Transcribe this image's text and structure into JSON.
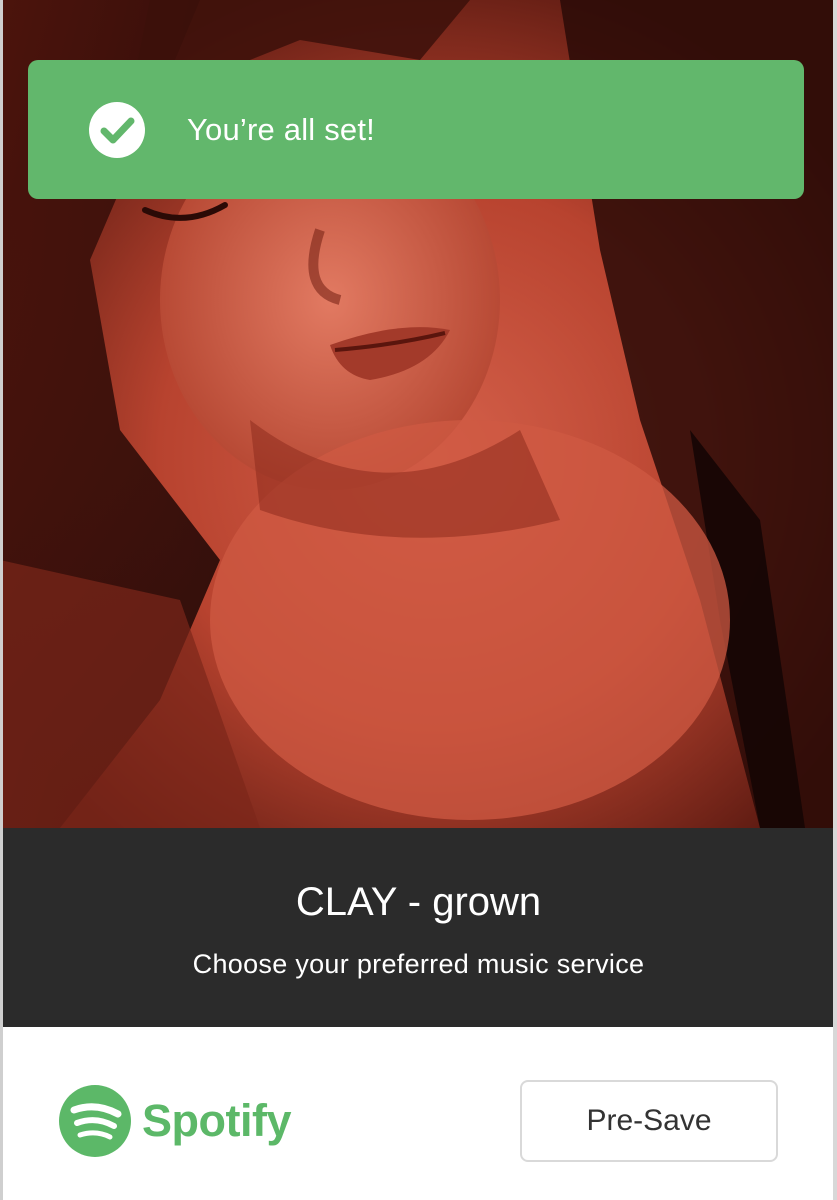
{
  "toast": {
    "message": "You’re all set!",
    "icon": "check-circle-icon",
    "color": "#62b76c"
  },
  "release": {
    "title": "CLAY - grown",
    "subtitle": "Choose your preferred music service"
  },
  "services": [
    {
      "name": "Spotify",
      "icon": "spotify-icon",
      "brand_color": "#5cb868",
      "action_label": "Pre-Save"
    }
  ],
  "colors": {
    "info_band": "#2b2b2b",
    "cover_tint": "#b9432f"
  }
}
